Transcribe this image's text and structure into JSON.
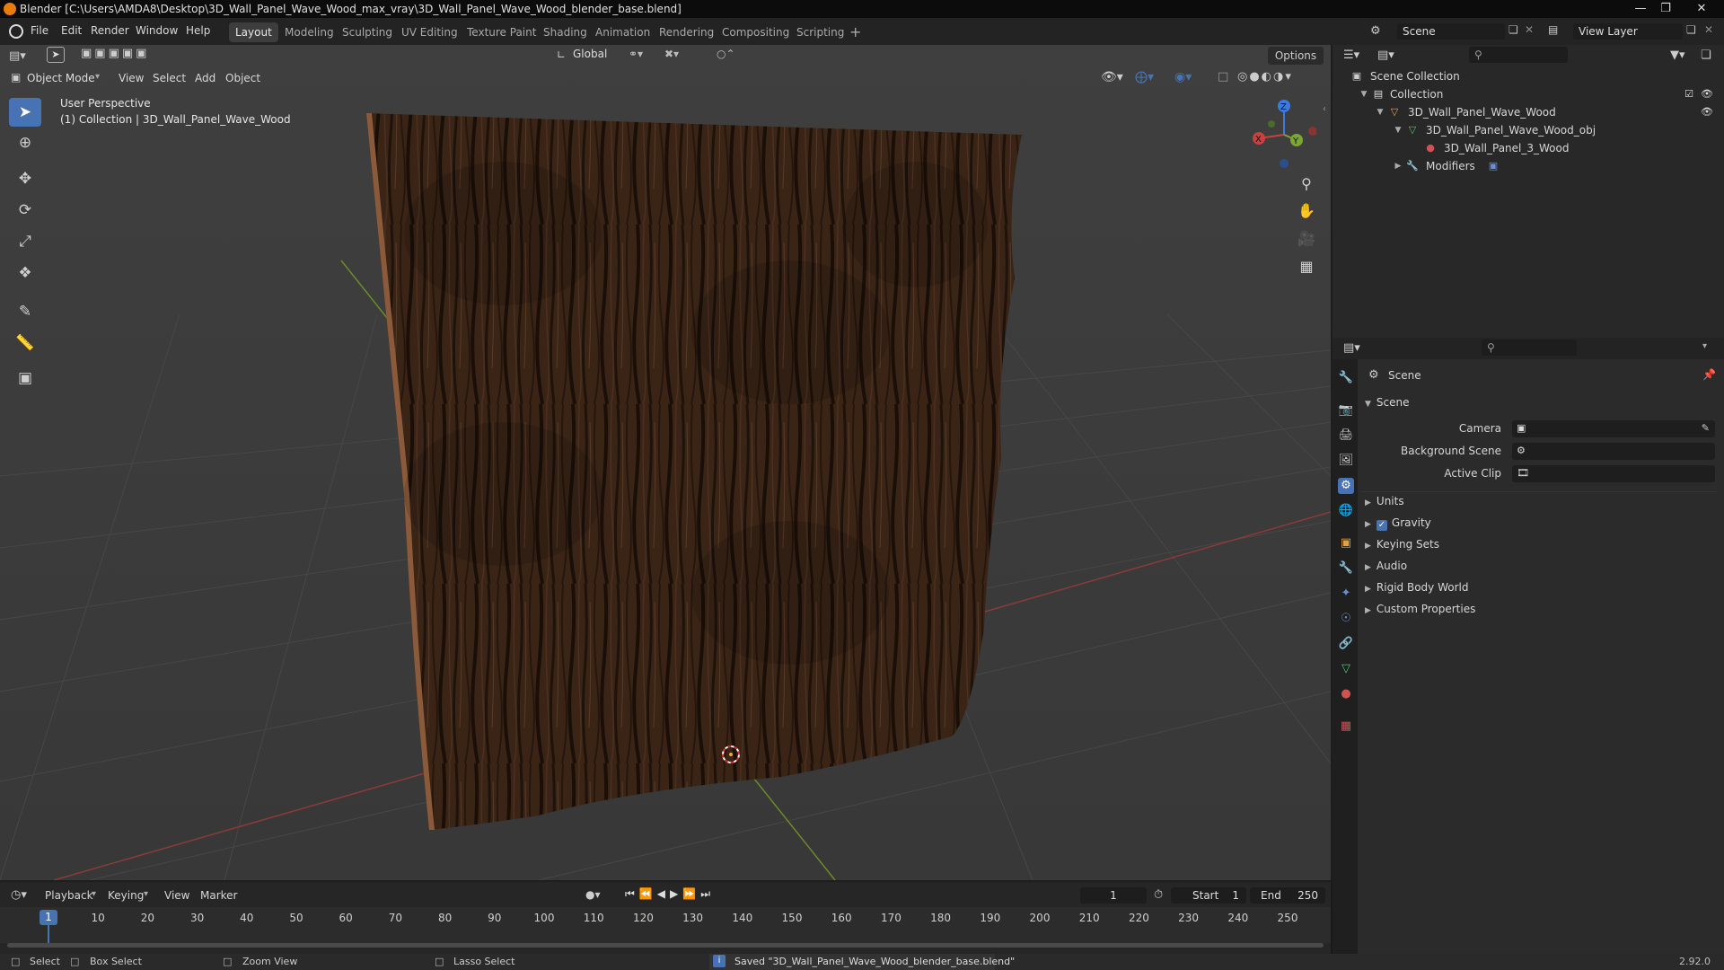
{
  "window": {
    "title": "Blender [C:\\Users\\AMDA8\\Desktop\\3D_Wall_Panel_Wave_Wood_max_vray\\3D_Wall_Panel_Wave_Wood_blender_base.blend]"
  },
  "menus": [
    "File",
    "Edit",
    "Render",
    "Window",
    "Help"
  ],
  "workspaces": [
    "Layout",
    "Modeling",
    "Sculpting",
    "UV Editing",
    "Texture Paint",
    "Shading",
    "Animation",
    "Rendering",
    "Compositing",
    "Scripting"
  ],
  "active_workspace": "Layout",
  "scene_selector": {
    "value": "Scene"
  },
  "view_layer_selector": {
    "value": "View Layer"
  },
  "viewport": {
    "mode": "Object Mode",
    "menus": [
      "View",
      "Select",
      "Add",
      "Object"
    ],
    "transform_orientation": "Global",
    "options_label": "Options",
    "overlay_line1": "User Perspective",
    "overlay_line2": "(1) Collection | 3D_Wall_Panel_Wave_Wood",
    "gizmo_axes": [
      "X",
      "Y",
      "Z"
    ]
  },
  "outliner": {
    "root": "Scene Collection",
    "collection": "Collection",
    "object": "3D_Wall_Panel_Wave_Wood",
    "mesh": "3D_Wall_Panel_Wave_Wood_obj",
    "material": "3D_Wall_Panel_3_Wood",
    "modifiers": "Modifiers"
  },
  "properties": {
    "context_title": "Scene",
    "section": "Scene",
    "fields": {
      "camera_label": "Camera",
      "background_label": "Background Scene",
      "active_clip_label": "Active Clip"
    },
    "panels": [
      "Units",
      "Gravity",
      "Keying Sets",
      "Audio",
      "Rigid Body World",
      "Custom Properties"
    ],
    "gravity_checked": true
  },
  "timeline": {
    "menus": [
      "Playback",
      "Keying",
      "View",
      "Marker"
    ],
    "current_frame": "1",
    "start_label": "Start",
    "start_value": "1",
    "end_label": "End",
    "end_value": "250",
    "ticks": [
      "1",
      "10",
      "20",
      "30",
      "40",
      "50",
      "60",
      "70",
      "80",
      "90",
      "100",
      "110",
      "120",
      "130",
      "140",
      "150",
      "160",
      "170",
      "180",
      "190",
      "200",
      "210",
      "220",
      "230",
      "240",
      "250"
    ]
  },
  "status": {
    "select": "Select",
    "box_select": "Box Select",
    "zoom_view": "Zoom View",
    "lasso_select": "Lasso Select",
    "message": "Saved \"3D_Wall_Panel_Wave_Wood_blender_base.blend\"",
    "version": "2.92.0"
  },
  "colors": {
    "accent": "#4772b3",
    "selection": "#334d80",
    "logo": "#e87d0d",
    "x_axis": "#c8413f",
    "y_axis": "#7aa631",
    "z_axis": "#3b7be0"
  }
}
